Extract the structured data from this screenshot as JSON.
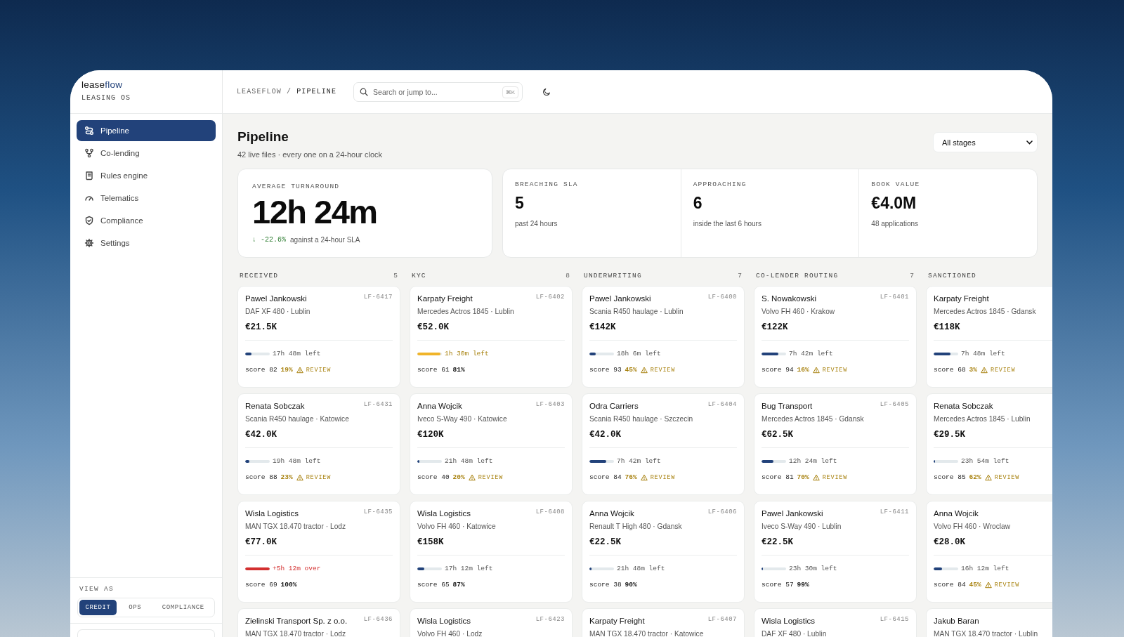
{
  "brand": {
    "prefix": "lease",
    "suffix": "flow",
    "tagline": "LEASING OS"
  },
  "nav": [
    {
      "label": "Pipeline",
      "selected": true
    },
    {
      "label": "Co-lending",
      "selected": false
    },
    {
      "label": "Rules engine",
      "selected": false
    },
    {
      "label": "Telematics",
      "selected": false
    },
    {
      "label": "Compliance",
      "selected": false
    },
    {
      "label": "Settings",
      "selected": false
    }
  ],
  "view_as": {
    "label": "VIEW AS",
    "options": [
      {
        "label": "CREDIT",
        "selected": true
      },
      {
        "label": "OPS",
        "selected": false
      },
      {
        "label": "COMPLIANCE",
        "selected": false
      }
    ]
  },
  "breadcrumb": {
    "parent": "LEASEFLOW",
    "separator": "/",
    "current": "PIPELINE"
  },
  "search": {
    "placeholder": "Search or jump to...",
    "shortcut": "⌘K"
  },
  "page": {
    "title": "Pipeline",
    "subtitle": "42 live files · every one on a 24-hour clock",
    "filter": "All stages"
  },
  "hero_stat": {
    "label": "AVERAGE TURNAROUND",
    "value": "12h 24m",
    "delta": "↓ -22.6%",
    "note": "against a 24-hour SLA"
  },
  "stats": [
    {
      "label": "BREACHING SLA",
      "value": "5",
      "note": "past 24 hours"
    },
    {
      "label": "APPROACHING",
      "value": "6",
      "note": "inside the last 6 hours"
    },
    {
      "label": "BOOK VALUE",
      "value": "€4.0M",
      "note": "48 applications"
    }
  ],
  "columns": [
    {
      "title": "RECEIVED",
      "count": "5",
      "cards": [
        {
          "name": "Pawel Jankowski",
          "id": "LF-6417",
          "asset": "DAF XF 480 · Lublin",
          "amount": "€21.5K",
          "timer": "17h 48m left",
          "kind": "ok",
          "level": 0.26,
          "score": "score 82",
          "match": "19%",
          "flag": "REVIEW"
        },
        {
          "name": "Renata Sobczak",
          "id": "LF-6431",
          "asset": "Scania R450 haulage · Katowice",
          "amount": "€42.0K",
          "timer": "19h 48m left",
          "kind": "ok",
          "level": 0.18,
          "score": "score 88",
          "match": "23%",
          "flag": "REVIEW"
        },
        {
          "name": "Wisla Logistics",
          "id": "LF-6435",
          "asset": "MAN TGX 18.470 tractor · Lodz",
          "amount": "€77.0K",
          "timer": "+5h 12m over",
          "kind": "over",
          "level": 1,
          "score": "score 69",
          "match": "100%"
        },
        {
          "name": "Zielinski Transport Sp. z o.o.",
          "id": "LF-6436",
          "asset": "MAN TGX 18.470 tractor · Lodz"
        }
      ]
    },
    {
      "title": "KYC",
      "count": "8",
      "cards": [
        {
          "name": "Karpaty Freight",
          "id": "LF-6402",
          "asset": "Mercedes Actros 1845 · Lublin",
          "amount": "€52.0K",
          "timer": "1h 30m left",
          "kind": "warning",
          "level": 0.94,
          "score": "score 61",
          "match": "81%"
        },
        {
          "name": "Anna Wojcik",
          "id": "LF-6403",
          "asset": "Iveco S-Way 490 · Katowice",
          "amount": "€120K",
          "timer": "21h 48m left",
          "kind": "ok",
          "level": 0.09,
          "score": "score 40",
          "match": "20%",
          "flag": "REVIEW"
        },
        {
          "name": "Wisla Logistics",
          "id": "LF-6408",
          "asset": "Volvo FH 460 · Katowice",
          "amount": "€158K",
          "timer": "17h 12m left",
          "kind": "ok",
          "level": 0.28,
          "score": "score 65",
          "match": "87%"
        },
        {
          "name": "Wisla Logistics",
          "id": "LF-6423",
          "asset": "Volvo FH 460 · Lodz"
        }
      ]
    },
    {
      "title": "UNDERWRITING",
      "count": "7",
      "cards": [
        {
          "name": "Pawel Jankowski",
          "id": "LF-6400",
          "asset": "Scania R450 haulage · Lublin",
          "amount": "€142K",
          "timer": "18h 6m left",
          "kind": "ok",
          "level": 0.25,
          "score": "score 93",
          "match": "45%",
          "flag": "REVIEW"
        },
        {
          "name": "Odra Carriers",
          "id": "LF-6404",
          "asset": "Scania R450 haulage · Szczecin",
          "amount": "€42.0K",
          "timer": "7h 42m left",
          "kind": "ok",
          "level": 0.68,
          "score": "score 84",
          "match": "76%",
          "flag": "REVIEW"
        },
        {
          "name": "Anna Wojcik",
          "id": "LF-6406",
          "asset": "Renault T High 480 · Gdansk",
          "amount": "€22.5K",
          "timer": "21h 48m left",
          "kind": "ok",
          "level": 0.09,
          "score": "score 38",
          "match": "90%"
        },
        {
          "name": "Karpaty Freight",
          "id": "LF-6407",
          "asset": "MAN TGX 18.470 tractor · Katowice"
        }
      ]
    },
    {
      "title": "CO-LENDER ROUTING",
      "count": "7",
      "cards": [
        {
          "name": "S. Nowakowski",
          "id": "LF-6401",
          "asset": "Volvo FH 460 · Krakow",
          "amount": "€122K",
          "timer": "7h 42m left",
          "kind": "ok",
          "level": 0.68,
          "score": "score 94",
          "match": "16%",
          "flag": "REVIEW"
        },
        {
          "name": "Bug Transport",
          "id": "LF-6405",
          "asset": "Mercedes Actros 1845 · Gdansk",
          "amount": "€62.5K",
          "timer": "12h 24m left",
          "kind": "ok",
          "level": 0.48,
          "score": "score 81",
          "match": "70%",
          "flag": "REVIEW"
        },
        {
          "name": "Pawel Jankowski",
          "id": "LF-6411",
          "asset": "Iveco S-Way 490 · Lublin",
          "amount": "€22.5K",
          "timer": "23h 30m left",
          "kind": "ok",
          "level": 0.02,
          "score": "score 57",
          "match": "99%"
        },
        {
          "name": "Wisla Logistics",
          "id": "LF-6415",
          "asset": "DAF XF 480 · Lublin"
        }
      ]
    },
    {
      "title": "SANCTIONED",
      "cards": [
        {
          "name": "Karpaty Freight",
          "asset": "Mercedes Actros 1845 · Gdansk",
          "amount": "€118K",
          "timer": "7h 48m left",
          "kind": "ok",
          "level": 0.68,
          "score": "score 68",
          "match": "3%",
          "flag": "REVIEW"
        },
        {
          "name": "Renata Sobczak",
          "asset": "Mercedes Actros 1845 · Lublin",
          "amount": "€29.5K",
          "timer": "23h 54m left",
          "kind": "ok",
          "level": 0.01,
          "score": "score 85",
          "match": "62%",
          "flag": "REVIEW"
        },
        {
          "name": "Anna Wojcik",
          "asset": "Volvo FH 460 · Wroclaw",
          "amount": "€28.0K",
          "timer": "16h 12m left",
          "kind": "ok",
          "level": 0.33,
          "score": "score 84",
          "match": "45%",
          "flag": "REVIEW"
        },
        {
          "name": "Jakub Baran",
          "asset": "MAN TGX 18.470 tractor · Lublin"
        }
      ]
    }
  ]
}
